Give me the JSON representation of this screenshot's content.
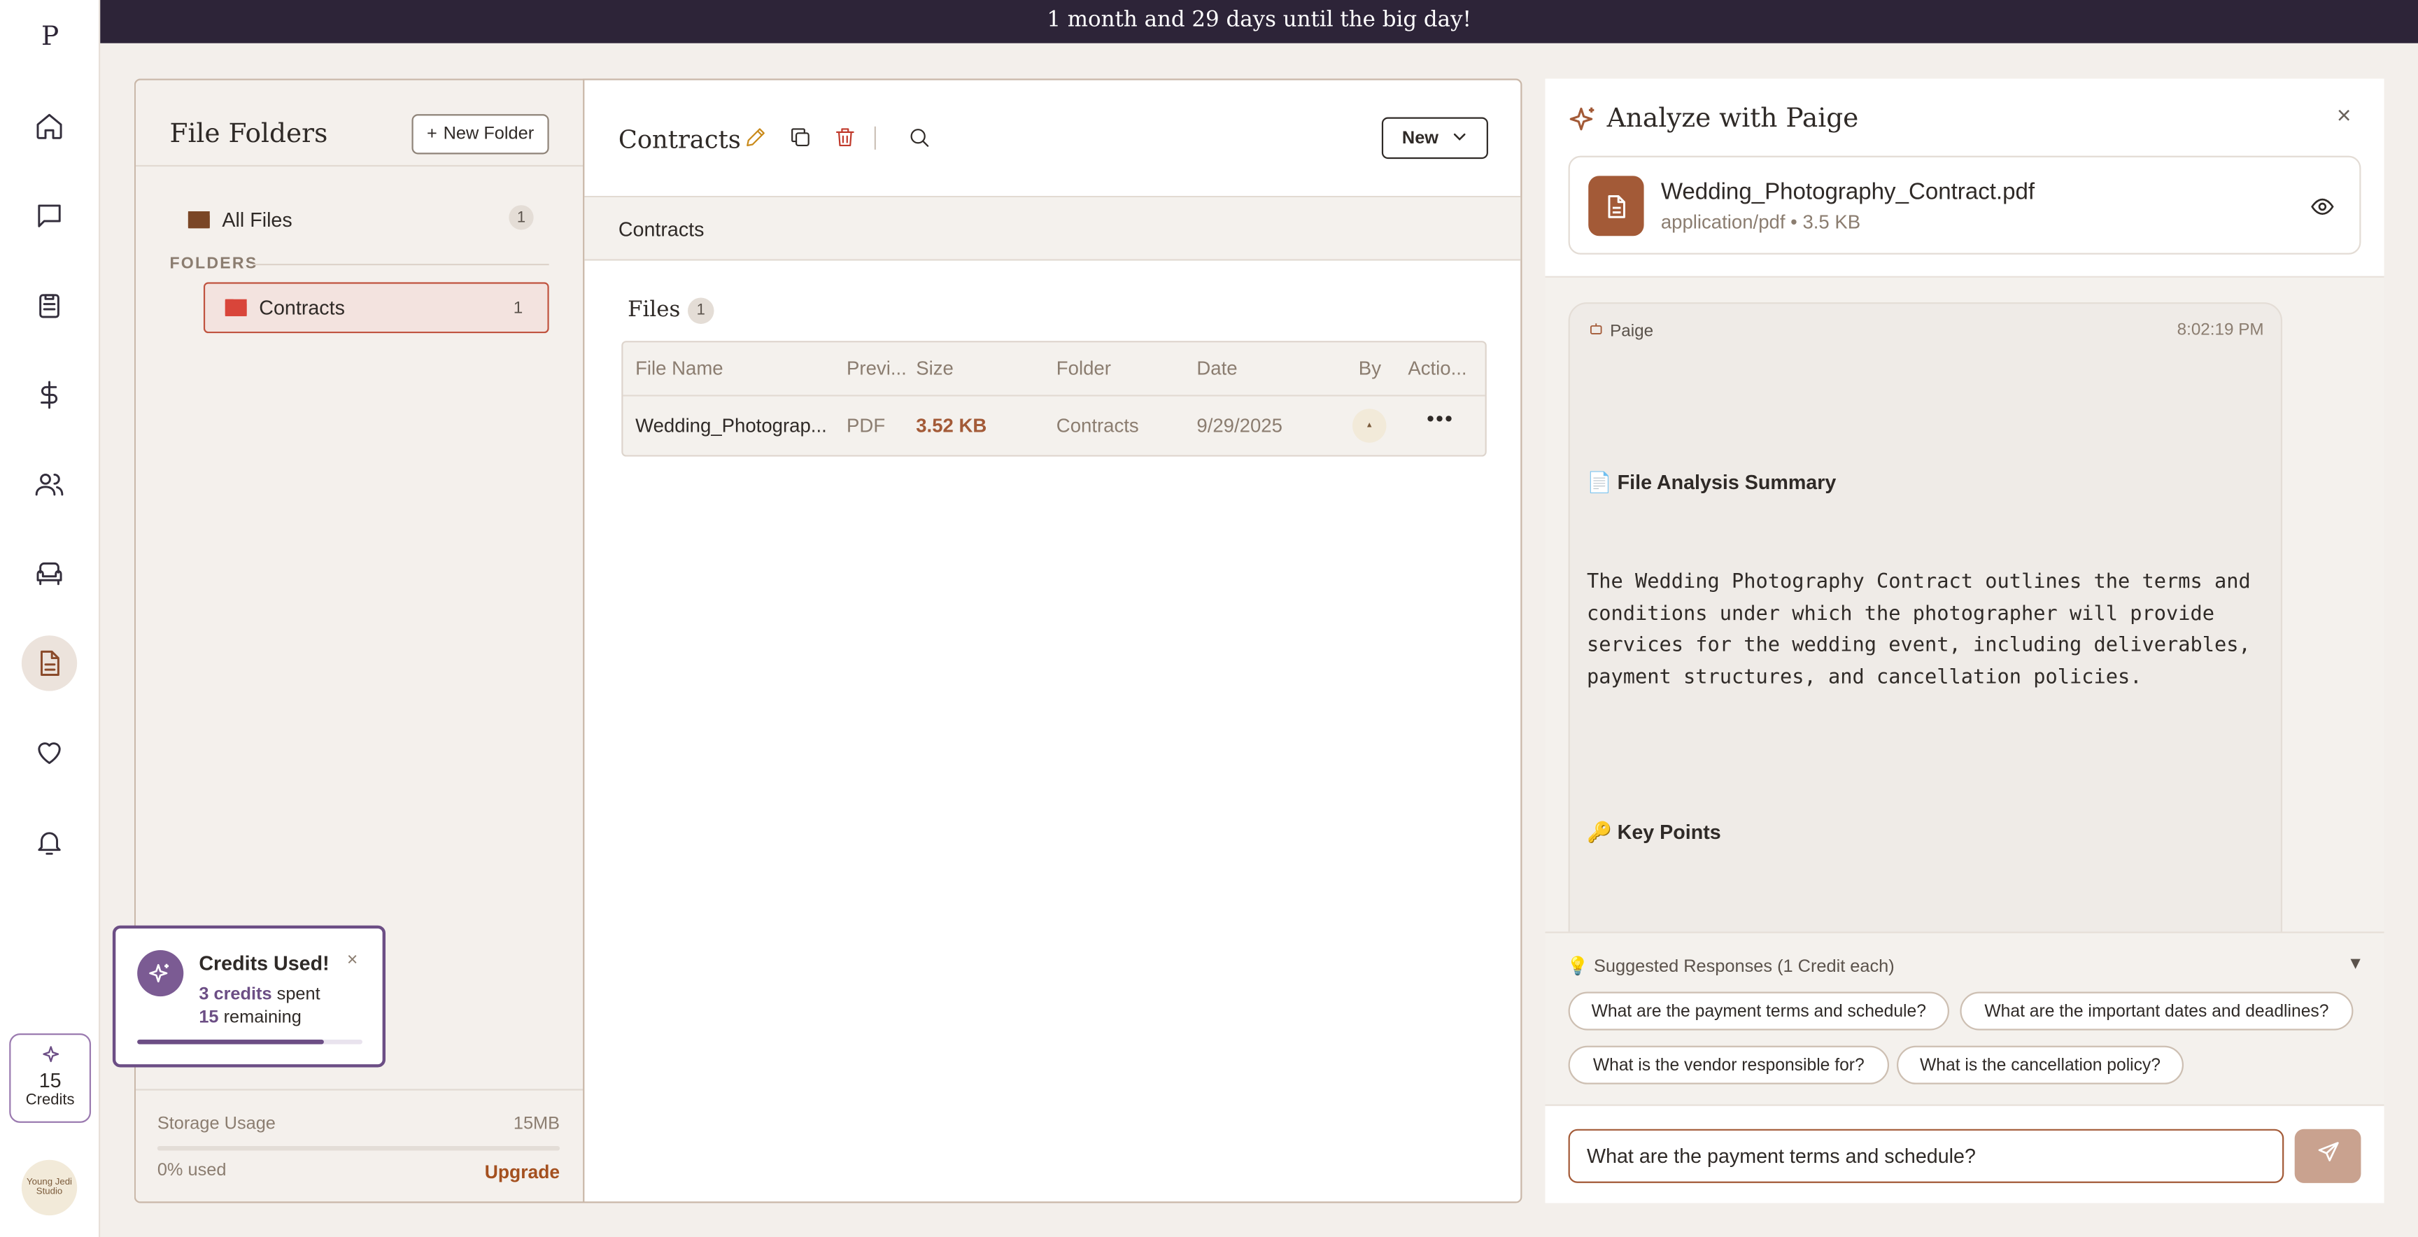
{
  "banner": {
    "text": "1 month and 29 days until the big day!"
  },
  "rail": {
    "logo": "P",
    "items": [
      {
        "icon": "home-icon"
      },
      {
        "icon": "messages-icon"
      },
      {
        "icon": "clipboard-icon"
      },
      {
        "icon": "dollar-icon"
      },
      {
        "icon": "guests-icon"
      },
      {
        "icon": "seating-icon"
      },
      {
        "icon": "files-icon",
        "active": true
      },
      {
        "icon": "heart-icon"
      },
      {
        "icon": "bell-icon"
      }
    ],
    "credits": {
      "count": "15",
      "label": "Credits"
    },
    "avatar_text": "Young Jedi Studio"
  },
  "folders": {
    "title": "File Folders",
    "new_folder_label": "New Folder",
    "all_files": {
      "label": "All Files",
      "count": "1"
    },
    "section_label": "FOLDERS",
    "items": [
      {
        "label": "Contracts",
        "count": "1"
      }
    ],
    "storage": {
      "label": "Storage Usage",
      "capacity": "15MB",
      "used_label": "0% used",
      "used_fraction": 0.0,
      "upgrade_label": "Upgrade"
    }
  },
  "files_panel": {
    "title": "Contracts",
    "new_button_label": "New",
    "breadcrumb": "Contracts",
    "files_label": "Files",
    "files_count": "1",
    "columns": [
      "File Name",
      "Previ...",
      "Size",
      "Folder",
      "Date",
      "By",
      "Actio..."
    ],
    "rows": [
      {
        "name": "Wedding_Photograp...",
        "preview": "PDF",
        "size": "3.52 KB",
        "folder": "Contracts",
        "date": "9/29/2025"
      }
    ]
  },
  "analyze": {
    "title": "Analyze with Paige",
    "file": {
      "name": "Wedding_Photography_Contract.pdf",
      "meta": "application/pdf • 3.5 KB"
    },
    "message": {
      "sender": "Paige",
      "time": "8:02:19 PM",
      "summary_title": "📄 File Analysis Summary",
      "summary_body": "The Wedding Photography Contract outlines the terms and conditions under which the photographer will provide services for the wedding event, including deliverables, payment structures, and cancellation policies.",
      "key_points_title": "🔑 Key Points"
    },
    "suggestions_title": "💡 Suggested Responses (1 Credit each)",
    "suggestions": [
      "What are the payment terms and schedule?",
      "What are the important dates and deadlines?",
      "What is the vendor responsible for?",
      "What is the cancellation policy?"
    ],
    "input_value": "What are the payment terms and schedule?"
  },
  "toast": {
    "title": "Credits Used!",
    "spent_value": "3 credits",
    "spent_suffix": " spent",
    "remaining_value": "15",
    "remaining_suffix": " remaining",
    "progress_fraction": 0.83
  },
  "colors": {
    "banner": "#2d2438",
    "accent": "#a35a37",
    "active_folder": "#d9453a",
    "toast_border": "#6c4e85"
  }
}
